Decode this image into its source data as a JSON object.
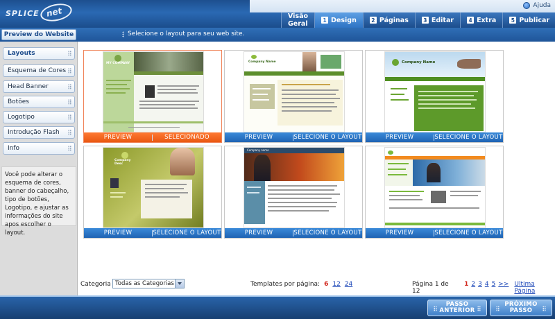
{
  "header": {
    "logo_text": "SPLICE",
    "logo_mark": "net",
    "help_label": "Ajuda",
    "tabs": [
      {
        "label": "Visão Geral",
        "num": "",
        "active": false
      },
      {
        "label": "Design",
        "num": "1",
        "active": true
      },
      {
        "label": "Páginas",
        "num": "2",
        "active": false
      },
      {
        "label": "Editar",
        "num": "3",
        "active": false
      },
      {
        "label": "Extra",
        "num": "4",
        "active": false
      },
      {
        "label": "Publicar",
        "num": "5",
        "active": false
      }
    ]
  },
  "subbar": {
    "preview_button": "Preview do Website",
    "instruction": "Selecione o layout para seu web site."
  },
  "sidebar": {
    "items": [
      "Layouts",
      "Esquema de Cores",
      "Head Banner",
      "Botões",
      "Logotipo",
      "Introdução Flash",
      "Info"
    ],
    "info_text": "Você pode alterar o esquema de cores, banner do cabeçalho, tipo de botões, Logotipo, e ajustar as informações do site apos escolher o layout."
  },
  "templates": [
    {
      "preview": "PREVIEW",
      "action": "SELECIONADO",
      "selected": true,
      "brand": "MY COMPANY"
    },
    {
      "preview": "PREVIEW",
      "action": "SELECIONE O LAYOUT",
      "selected": false,
      "brand": "Company Name"
    },
    {
      "preview": "PREVIEW",
      "action": "SELECIONE O LAYOUT",
      "selected": false,
      "brand": "Company Name"
    },
    {
      "preview": "PREVIEW",
      "action": "SELECIONE O LAYOUT",
      "selected": false,
      "brand": "Company Desc"
    },
    {
      "preview": "PREVIEW",
      "action": "SELECIONE O LAYOUT",
      "selected": false,
      "brand": "Company name"
    },
    {
      "preview": "PREVIEW",
      "action": "SELECIONE O LAYOUT",
      "selected": false,
      "brand": ""
    }
  ],
  "filters": {
    "category_label": "Categoria",
    "category_value": "Todas as Categorias",
    "per_page_label": "Templates por página:",
    "per_page_options": [
      "6",
      "12",
      "24"
    ],
    "per_page_current": "6"
  },
  "pagination": {
    "label": "Página 1 de 12",
    "pages": [
      "1",
      "2",
      "3",
      "4",
      "5"
    ],
    "current": "1",
    "next": ">>",
    "last": "Ultima Página"
  },
  "footer": {
    "prev_button": "PASSO ANTERIOR",
    "next_button": "PRÓXIMO PASSO"
  },
  "colors": {
    "primary_blue": "#2a69b3",
    "selected_orange": "#f26a24",
    "link_blue": "#1c47b8",
    "current_red": "#d2281e"
  }
}
